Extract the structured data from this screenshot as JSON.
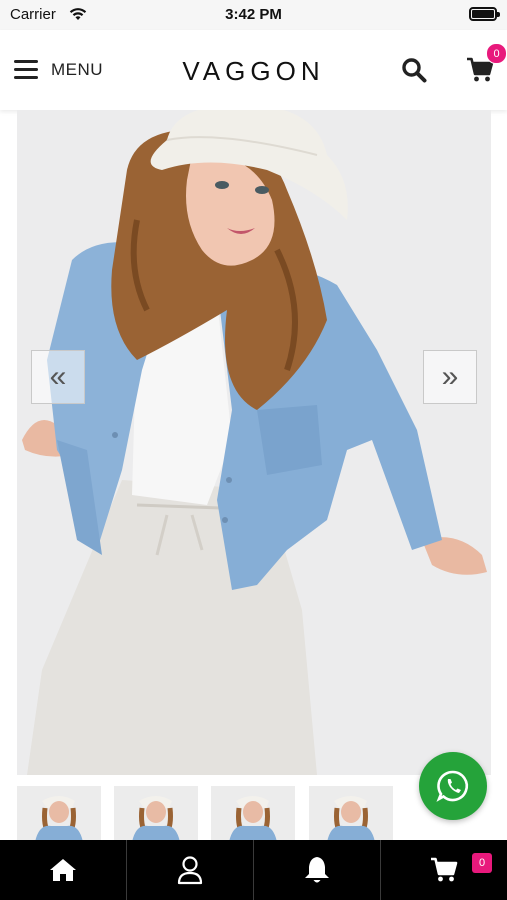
{
  "status_bar": {
    "carrier": "Carrier",
    "time": "3:42 PM"
  },
  "header": {
    "menu_label": "MENU",
    "brand": "VAGGON",
    "cart_count": "0"
  },
  "product": {
    "slider_prev_icon": "double-chevron-left-icon",
    "slider_next_icon": "double-chevron-right-icon",
    "thumbnail_count": 4
  },
  "bottom_nav": {
    "items": [
      {
        "icon": "home-icon"
      },
      {
        "icon": "user-icon"
      },
      {
        "icon": "bell-icon"
      },
      {
        "icon": "cart-icon"
      }
    ],
    "cart_count": "0"
  },
  "colors": {
    "accent_badge": "#e8197c",
    "whatsapp": "#25a33a",
    "bottom_nav_bg": "#000000"
  }
}
